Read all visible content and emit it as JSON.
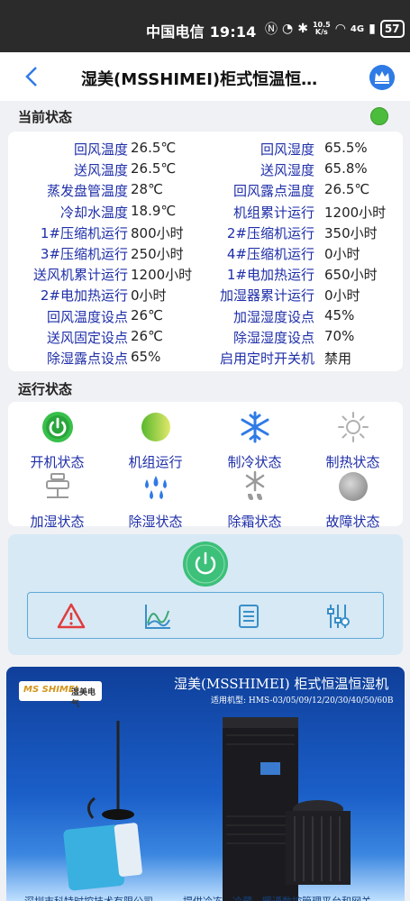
{
  "statusbar": {
    "carrier_time": "中国电信 19:14",
    "net_speed_top": "10.5",
    "net_speed_bottom": "K/s",
    "network": "4G",
    "battery": "57"
  },
  "header": {
    "title": "湿美(MSSHIMEI)柜式恒温恒…"
  },
  "current_status": {
    "label": "当前状态",
    "rows": [
      {
        "l1": "回风温度",
        "v1": "26.5℃",
        "l2": "回风湿度",
        "v2": "65.5%"
      },
      {
        "l1": "送风温度",
        "v1": "26.5℃",
        "l2": "送风湿度",
        "v2": "65.8%"
      },
      {
        "l1": "蒸发盘管温度",
        "v1": "28℃",
        "l2": "回风露点温度",
        "v2": "26.5℃"
      },
      {
        "l1": "冷却水温度",
        "v1": "18.9℃",
        "l2": "机组累计运行",
        "v2": "1200小时"
      },
      {
        "l1": "1#压缩机运行",
        "v1": "800小时",
        "l2": "2#压缩机运行",
        "v2": "350小时"
      },
      {
        "l1": "3#压缩机运行",
        "v1": "250小时",
        "l2": "4#压缩机运行",
        "v2": "0小时"
      },
      {
        "l1": "送风机累计运行",
        "v1": "1200小时",
        "l2": "1#电加热运行",
        "v2": "650小时"
      },
      {
        "l1": "2#电加热运行",
        "v1": "0小时",
        "l2": "加湿器累计运行",
        "v2": "0小时"
      },
      {
        "l1": "回风温度设点",
        "v1": "26℃",
        "l2": "加湿湿度设点",
        "v2": "45%"
      },
      {
        "l1": "送风固定设点",
        "v1": "26℃",
        "l2": "除湿湿度设点",
        "v2": "70%"
      },
      {
        "l1": "除湿露点设点",
        "v1": "65%",
        "l2": "启用定时开关机",
        "v2": "禁用"
      }
    ]
  },
  "run_status": {
    "label": "运行状态",
    "items": [
      {
        "label": "开机状态",
        "icon": "power-on-icon"
      },
      {
        "label": "机组运行",
        "icon": "unit-running-icon"
      },
      {
        "label": "制冷状态",
        "icon": "snowflake-icon"
      },
      {
        "label": "制热状态",
        "icon": "sun-icon"
      },
      {
        "label": "加湿状态",
        "icon": "humidifier-icon"
      },
      {
        "label": "除湿状态",
        "icon": "water-drops-icon"
      },
      {
        "label": "除霜状态",
        "icon": "defrost-icon"
      },
      {
        "label": "故障状态",
        "icon": "fault-indicator-icon"
      }
    ]
  },
  "controls": {
    "power": "power-button-icon",
    "tools": [
      "alarm-warning-icon",
      "trend-chart-icon",
      "log-list-icon",
      "settings-sliders-icon"
    ]
  },
  "banner": {
    "logo_brand": "MS SHIMEI",
    "logo_cn": "湿美电气",
    "title": "湿美(MSSHIMEI) 柜式恒温恒湿机",
    "models": "适用机型: HMS-03/05/09/12/20/30/40/50/60B",
    "footer_left": "深圳市科特时控技术有限公司",
    "footer_right": "提供冷冻、冷藏、暖通数控管理平台和网关"
  },
  "colors": {
    "label_blue": "#1e2ea8",
    "online_green": "#4cbc3c",
    "power_green": "#3cc07a",
    "header_accent": "#2f7be6"
  }
}
